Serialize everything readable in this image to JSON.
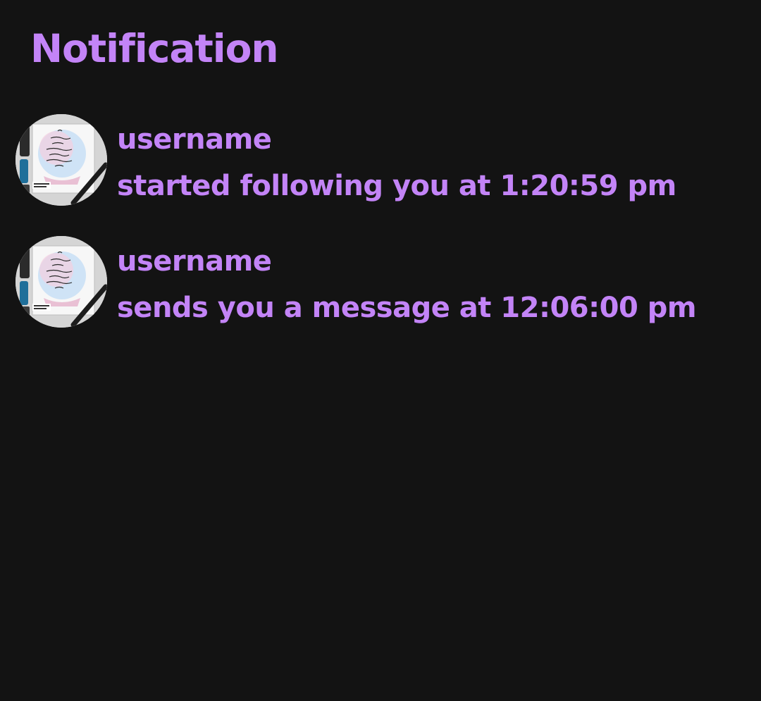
{
  "page": {
    "title": "Notification"
  },
  "colors": {
    "background": "#131313",
    "accent": "#c384f7"
  },
  "notifications": [
    {
      "avatar_icon": "avatar-image",
      "username": "username",
      "message": "started following you at 1:20:59 pm"
    },
    {
      "avatar_icon": "avatar-image",
      "username": "username",
      "message": "sends you a message at 12:06:00 pm"
    }
  ]
}
